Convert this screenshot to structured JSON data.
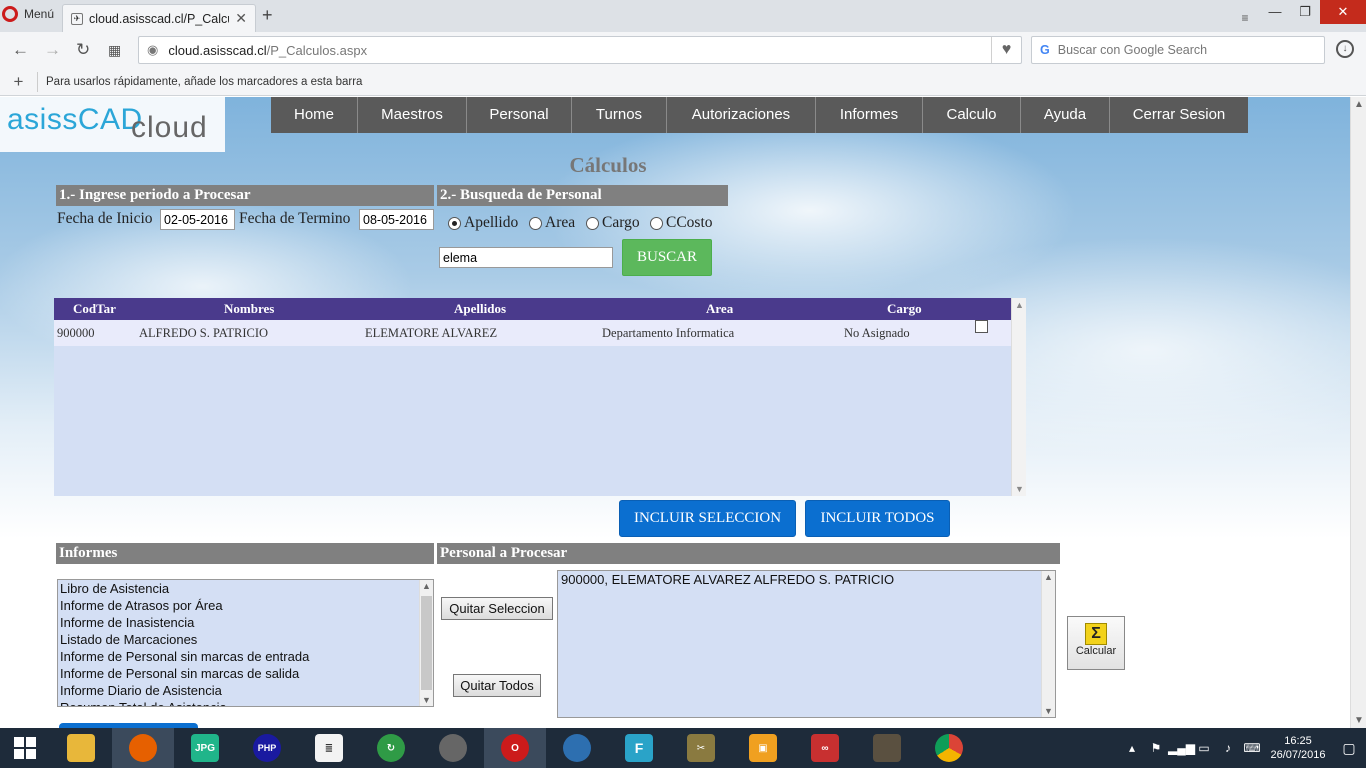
{
  "browser": {
    "menu_label": "Menú",
    "tab_title": "cloud.asisscad.cl/P_Calculos",
    "url_host": "cloud.asisscad.cl",
    "url_path": "/P_Calculos.aspx",
    "search_placeholder": "Buscar con Google Search",
    "bookmarks_hint": "Para usarlos rápidamente, añade los marcadores a esta barra"
  },
  "logo": {
    "part1": "asissCAD",
    "part2": "cloud"
  },
  "nav": [
    "Home",
    "Maestros",
    "Personal",
    "Turnos",
    "Autorizaciones",
    "Informes",
    "Calculo",
    "Ayuda",
    "Cerrar Sesion"
  ],
  "page_title": "Cálculos",
  "period": {
    "header": "1.- Ingrese periodo a Procesar",
    "start_label": "Fecha de Inicio",
    "start_value": "02-05-2016",
    "end_label": "Fecha de Termino",
    "end_value": "08-05-2016"
  },
  "search": {
    "header": "2.- Busqueda de Personal",
    "options": [
      "Apellido",
      "Area",
      "Cargo",
      "CCosto"
    ],
    "selected": "Apellido",
    "value": "elema",
    "button": "BUSCAR"
  },
  "grid": {
    "columns": [
      "CodTar",
      "Nombres",
      "Apellidos",
      "Area",
      "Cargo"
    ],
    "rows": [
      {
        "codtar": "900000",
        "nombres": "ALFREDO S. PATRICIO",
        "apellidos": "ELEMATORE ALVAREZ",
        "area": "Departamento Informatica",
        "cargo": "No Asignado"
      }
    ]
  },
  "include": {
    "selection": "INCLUIR SELECCION",
    "all": "INCLUIR TODOS"
  },
  "informes": {
    "header": "Informes",
    "items": [
      "Libro de Asistencia",
      "Informe de Atrasos por Área",
      "Informe de Inasistencia",
      "Listado de Marcaciones",
      "Informe de Personal sin marcas de entrada",
      "Informe de Personal sin marcas de salida",
      "Informe Diario de Asistencia",
      "Resumen Total de Asistencia"
    ]
  },
  "procesar": {
    "header": "Personal a Procesar",
    "items": [
      "900000, ELEMATORE ALVAREZ ALFREDO S. PATRICIO"
    ],
    "remove_selection": "Quitar Seleccion",
    "remove_all": "Quitar Todos"
  },
  "calc_button": "Calcular",
  "taskbar": {
    "time": "16:25",
    "date": "26/07/2016",
    "apps": [
      "file-explorer",
      "firefox",
      "jpg-viewer",
      "php",
      "document",
      "globe-refresh",
      "circle-app",
      "opera",
      "thunderbird",
      "f-app",
      "tools",
      "box-app",
      "infinity-app",
      "avatar-app",
      "chrome"
    ]
  },
  "colors": {
    "nav_bg": "#5a5a5a",
    "grid_header": "#4a3a8c",
    "buscar_green": "#5cb85c",
    "include_blue": "#0b6fd0",
    "section_header": "#808080"
  }
}
